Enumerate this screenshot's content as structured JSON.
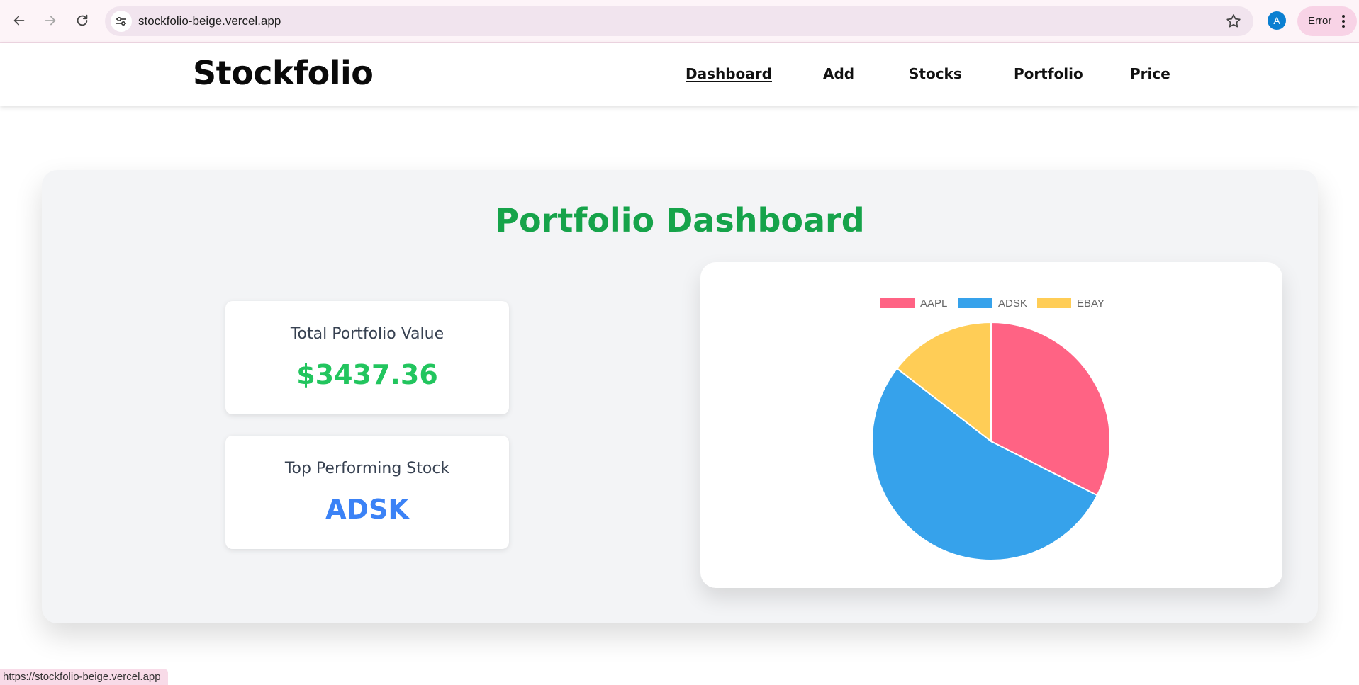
{
  "browser": {
    "url": "stockfolio-beige.vercel.app",
    "profile_initial": "A",
    "error_label": "Error",
    "status_url": "https://stockfolio-beige.vercel.app"
  },
  "header": {
    "brand": "Stockfolio",
    "nav": [
      {
        "label": "Dashboard",
        "active": true
      },
      {
        "label": "Add"
      },
      {
        "label": "Stocks"
      },
      {
        "label": "Portfolio"
      },
      {
        "label": "Price"
      }
    ]
  },
  "dashboard": {
    "title": "Portfolio Dashboard",
    "total_label": "Total Portfolio Value",
    "total_value": "$3437.36",
    "top_label": "Top Performing Stock",
    "top_value": "ADSK"
  },
  "colors": {
    "title_green": "#16a34a",
    "value_green": "#22c55e",
    "ticker_blue": "#3b82f6"
  },
  "chart_data": {
    "type": "pie",
    "categories": [
      "AAPL",
      "ADSK",
      "EBAY"
    ],
    "values": [
      32.5,
      53.0,
      14.5
    ],
    "colors": [
      "#ff6384",
      "#36a2eb",
      "#ffcd56"
    ],
    "legend": "top"
  }
}
